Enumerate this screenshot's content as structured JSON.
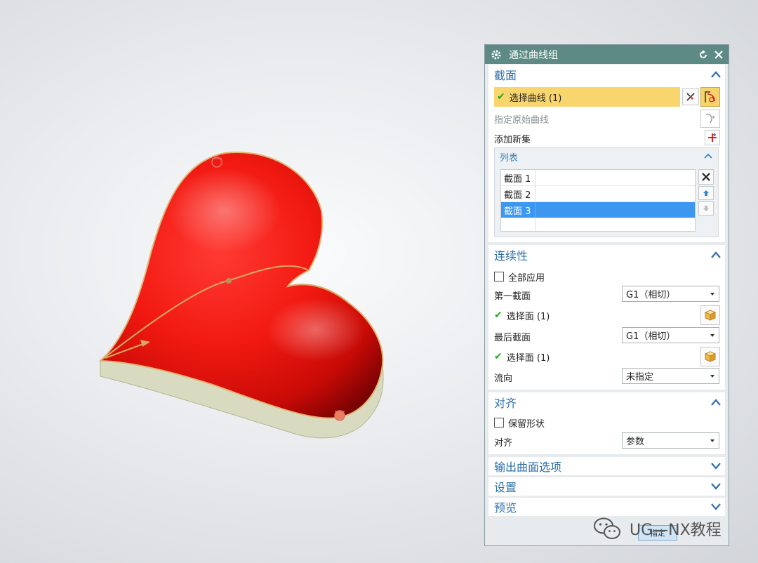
{
  "dialog": {
    "title": "通过曲线组",
    "reset_icon": "reset-icon",
    "close_icon": "close-icon"
  },
  "section_profile": {
    "title": "截面",
    "select_curve": "选择曲线 (1)",
    "specify_origin": "指定原始曲线",
    "add_new_set": "添加新集",
    "list": {
      "title": "列表",
      "items": [
        "截面 1",
        "截面 2",
        "截面 3"
      ],
      "selected_index": 2
    }
  },
  "section_continuity": {
    "title": "连续性",
    "apply_all": "全部应用",
    "apply_all_checked": false,
    "first_section_label": "第一截面",
    "first_section_value": "G1（相切）",
    "first_select_face": "选择面 (1)",
    "last_section_label": "最后截面",
    "last_section_value": "G1（相切）",
    "last_select_face": "选择面 (1)",
    "flow_label": "流向",
    "flow_value": "未指定"
  },
  "section_alignment": {
    "title": "对齐",
    "keep_shape": "保留形状",
    "keep_shape_checked": false,
    "align_label": "对齐",
    "align_value": "参数"
  },
  "collapsed_sections": {
    "output": "输出曲面选项",
    "settings": "设置",
    "preview": "预览"
  },
  "footer": {
    "ok_label": "指定"
  },
  "watermark": {
    "text": "UG—NX教程"
  },
  "colors": {
    "title_bar": "#5d8a84",
    "section_header": "#2d6fa8",
    "highlight_row": "#f9d56e",
    "selected_item": "#3d96f0",
    "heart_red": "#e0140e",
    "check_green": "#2aa52a"
  }
}
